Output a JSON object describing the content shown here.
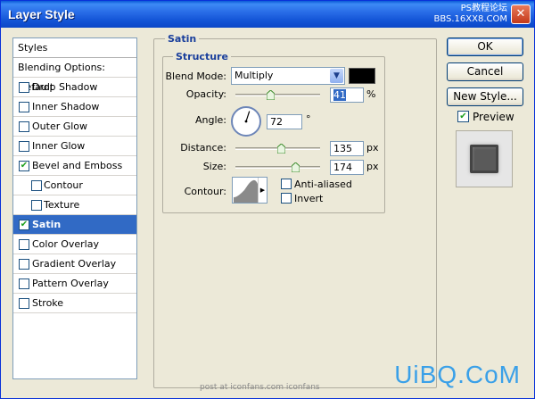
{
  "window": {
    "title": "Layer Style",
    "watermark_line1": "PS教程论坛",
    "watermark_line2": "BBS.16XX8.COM",
    "close_glyph": "✕"
  },
  "styles": {
    "header": "Styles",
    "items": [
      {
        "label": "Blending Options: Default",
        "checkbox": false,
        "checked": false,
        "sub": false,
        "selected": false
      },
      {
        "label": "Drop Shadow",
        "checkbox": true,
        "checked": false,
        "sub": false,
        "selected": false
      },
      {
        "label": "Inner Shadow",
        "checkbox": true,
        "checked": false,
        "sub": false,
        "selected": false
      },
      {
        "label": "Outer Glow",
        "checkbox": true,
        "checked": false,
        "sub": false,
        "selected": false
      },
      {
        "label": "Inner Glow",
        "checkbox": true,
        "checked": false,
        "sub": false,
        "selected": false
      },
      {
        "label": "Bevel and Emboss",
        "checkbox": true,
        "checked": true,
        "sub": false,
        "selected": false
      },
      {
        "label": "Contour",
        "checkbox": true,
        "checked": false,
        "sub": true,
        "selected": false
      },
      {
        "label": "Texture",
        "checkbox": true,
        "checked": false,
        "sub": true,
        "selected": false
      },
      {
        "label": "Satin",
        "checkbox": true,
        "checked": true,
        "sub": false,
        "selected": true
      },
      {
        "label": "Color Overlay",
        "checkbox": true,
        "checked": false,
        "sub": false,
        "selected": false
      },
      {
        "label": "Gradient Overlay",
        "checkbox": true,
        "checked": false,
        "sub": false,
        "selected": false
      },
      {
        "label": "Pattern Overlay",
        "checkbox": true,
        "checked": false,
        "sub": false,
        "selected": false
      },
      {
        "label": "Stroke",
        "checkbox": true,
        "checked": false,
        "sub": false,
        "selected": false
      }
    ]
  },
  "satin": {
    "group_label": "Satin",
    "structure_label": "Structure",
    "blend_mode_label": "Blend Mode:",
    "blend_mode_value": "Multiply",
    "blend_color": "#000000",
    "opacity_label": "Opacity:",
    "opacity_value": "41",
    "opacity_unit": "%",
    "opacity_fraction": 0.41,
    "angle_label": "Angle:",
    "angle_value": "72",
    "angle_unit": "°",
    "angle_degrees": 72,
    "distance_label": "Distance:",
    "distance_value": "135",
    "distance_unit": "px",
    "distance_fraction": 0.54,
    "size_label": "Size:",
    "size_value": "174",
    "size_unit": "px",
    "size_fraction": 0.7,
    "contour_label": "Contour:",
    "anti_aliased_label": "Anti-aliased",
    "anti_aliased_checked": false,
    "invert_label": "Invert",
    "invert_checked": false
  },
  "buttons": {
    "ok": "OK",
    "cancel": "Cancel",
    "new_style": "New Style...",
    "preview_label": "Preview",
    "preview_checked": true
  },
  "footer": {
    "note": "post at iconfans.com  iconfans",
    "logo": "UiBQ.CoM"
  },
  "icons": {
    "check": "✔",
    "dropdown": "▼",
    "dropdown_small": "▶"
  }
}
